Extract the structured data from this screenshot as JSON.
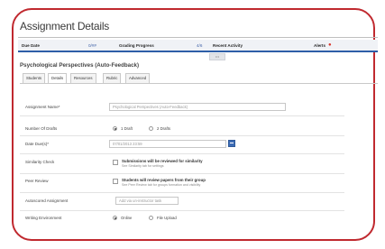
{
  "page": {
    "title": "Assignment Details",
    "subtitle": "Psychological Perspectives (Auto-Feedback)"
  },
  "statusbar": {
    "due_date": "Due Date",
    "due_count": "0/##",
    "grading_progress": "Grading Progress",
    "grading_count": "4/6",
    "recent_activity": "Recent Activity",
    "alerts": "Alerts",
    "alert_icon": "alert-icon",
    "accent": "#2e5fa8",
    "alert_color": "#d9342b"
  },
  "tabs": [
    {
      "label": "Students"
    },
    {
      "label": "Details"
    },
    {
      "label": "Resources"
    },
    {
      "label": "Rubric"
    },
    {
      "label": "Advanced"
    }
  ],
  "form": {
    "assignment_name": {
      "label": "Assignment Name*",
      "value": "Psychological Perspectives (Auto-Feedback)"
    },
    "number_of_drafts": {
      "label": "Number Of Drafts",
      "options": [
        "1 Draft",
        "2 Drafts"
      ],
      "selected": "1 Draft"
    },
    "date_due": {
      "label": "Date Due(s)*",
      "value": "07/01/2013 23:59",
      "icon": "calendar-icon"
    },
    "similarity_check": {
      "label": "Similarity Check",
      "title": "Submissions will be reviewed for similarity",
      "sub": "See Similarity tab for settings"
    },
    "peer_review": {
      "label": "Peer Review",
      "title": "Students will review papers from their group",
      "sub": "See Peer Review tab for groups formation and visibility"
    },
    "autoscored": {
      "label": "Autoscored Assignment",
      "placeholder": "Add via un-instructor task"
    },
    "writing_environment": {
      "label": "Writing Environment",
      "options": [
        "Online",
        "File Upload"
      ],
      "selected": "Online"
    }
  }
}
